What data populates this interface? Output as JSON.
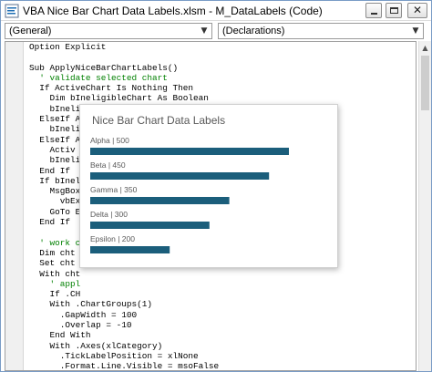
{
  "window": {
    "title": "VBA Nice Bar Chart Data Labels.xlsm - M_DataLabels (Code)",
    "close_glyph": "✕"
  },
  "object_combo": {
    "value": "(General)"
  },
  "proc_combo": {
    "value": "(Declarations)"
  },
  "code": {
    "lines": [
      {
        "text": "Option Explicit",
        "kind": "code"
      },
      {
        "text": "",
        "kind": "code"
      },
      {
        "text": "Sub ApplyNiceBarChartLabels()",
        "kind": "code"
      },
      {
        "text": "  ' validate selected chart",
        "kind": "comment"
      },
      {
        "text": "  If ActiveChart Is Nothing Then",
        "kind": "code"
      },
      {
        "text": "    Dim bIneligibleChart As Boolean",
        "kind": "code"
      },
      {
        "text": "    bInelig",
        "kind": "code"
      },
      {
        "text": "  ElseIf A",
        "kind": "code"
      },
      {
        "text": "    bInelig",
        "kind": "code"
      },
      {
        "text": "  ElseIf A",
        "kind": "code"
      },
      {
        "text": "    Activ",
        "kind": "code"
      },
      {
        "text": "    bInelig",
        "kind": "code"
      },
      {
        "text": "  End If",
        "kind": "code"
      },
      {
        "text": "  If bInel",
        "kind": "code"
      },
      {
        "text": "    MsgBox",
        "kind": "code"
      },
      {
        "text": "      vbEx",
        "kind": "code"
      },
      {
        "text": "    GoTo E",
        "kind": "code"
      },
      {
        "text": "  End If",
        "kind": "code"
      },
      {
        "text": "",
        "kind": "code"
      },
      {
        "text": "  ' work c",
        "kind": "comment"
      },
      {
        "text": "  Dim cht",
        "kind": "code"
      },
      {
        "text": "  Set cht",
        "kind": "code"
      },
      {
        "text": "  With cht",
        "kind": "code"
      },
      {
        "text": "    ' appl",
        "kind": "comment"
      },
      {
        "text": "    If .CH",
        "kind": "code"
      },
      {
        "text": "    With .ChartGroups(1)",
        "kind": "code"
      },
      {
        "text": "      .GapWidth = 100",
        "kind": "code"
      },
      {
        "text": "      .Overlap = -10",
        "kind": "code"
      },
      {
        "text": "    End With",
        "kind": "code"
      },
      {
        "text": "    With .Axes(xlCategory)",
        "kind": "code"
      },
      {
        "text": "      .TickLabelPosition = xlNone",
        "kind": "code"
      },
      {
        "text": "      .Format.Line.Visible = msoFalse",
        "kind": "code"
      },
      {
        "text": "    End With",
        "kind": "code"
      }
    ]
  },
  "chart_data": {
    "type": "bar",
    "title": "Nice Bar Chart Data Labels",
    "categories": [
      "Alpha",
      "Beta",
      "Gamma",
      "Delta",
      "Epsilon"
    ],
    "values": [
      500,
      450,
      350,
      300,
      200
    ],
    "data_labels": [
      "Alpha | 500",
      "Beta | 450",
      "Gamma | 350",
      "Delta | 300",
      "Epsilon | 200"
    ],
    "bar_color": "#1b5e7b",
    "label_color": "#595959",
    "orientation": "horizontal",
    "xlim": [
      0,
      500
    ],
    "grid": false,
    "legend": "none",
    "axes_visible": false
  },
  "colors": {
    "comment": "#008000",
    "keyword": "#00008b",
    "window_border": "#7a9cc6"
  }
}
